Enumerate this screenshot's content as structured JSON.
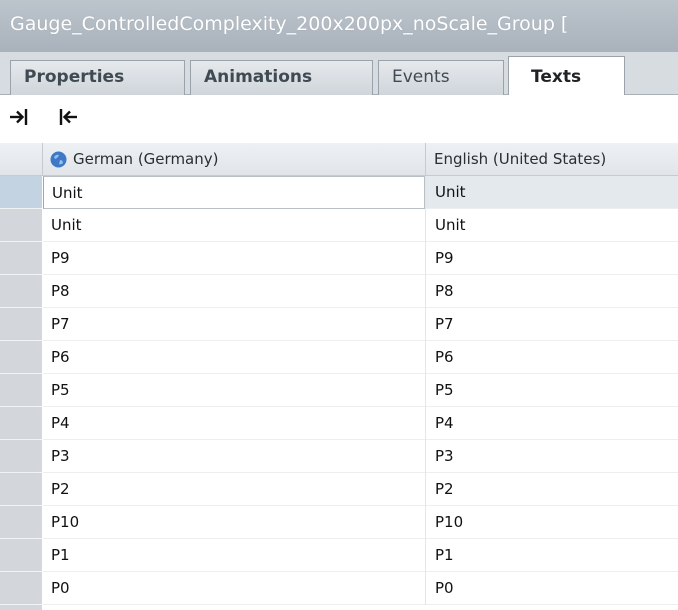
{
  "window": {
    "title": "Gauge_ControlledComplexity_200x200px_noScale_Group ["
  },
  "tabs": [
    {
      "label": "Properties",
      "active": false
    },
    {
      "label": "Animations",
      "active": false
    },
    {
      "label": "Events",
      "active": false
    },
    {
      "label": "Texts",
      "active": true
    }
  ],
  "toolbar": {
    "buttons": [
      {
        "icon": "arrow-right-into-bar-icon"
      },
      {
        "icon": "arrow-left-into-bar-icon"
      }
    ]
  },
  "grid": {
    "columns": [
      {
        "label": "German (Germany)",
        "icon": "globe-icon"
      },
      {
        "label": "English (United States)"
      }
    ],
    "selected_row": 0,
    "rows": [
      {
        "de": "Unit",
        "en": "Unit"
      },
      {
        "de": "Unit",
        "en": "Unit"
      },
      {
        "de": "P9",
        "en": "P9"
      },
      {
        "de": "P8",
        "en": "P8"
      },
      {
        "de": "P7",
        "en": "P7"
      },
      {
        "de": "P6",
        "en": "P6"
      },
      {
        "de": "P5",
        "en": "P5"
      },
      {
        "de": "P4",
        "en": "P4"
      },
      {
        "de": "P3",
        "en": "P3"
      },
      {
        "de": "P2",
        "en": "P2"
      },
      {
        "de": "P10",
        "en": "P10"
      },
      {
        "de": "P1",
        "en": "P1"
      },
      {
        "de": "P0",
        "en": "P0"
      }
    ]
  },
  "colors": {
    "title_bar": "#b4bcc4",
    "active_tab": "#ffffff",
    "row_header": "#d3d7db",
    "selected_row_header": "#c3d3e1"
  }
}
